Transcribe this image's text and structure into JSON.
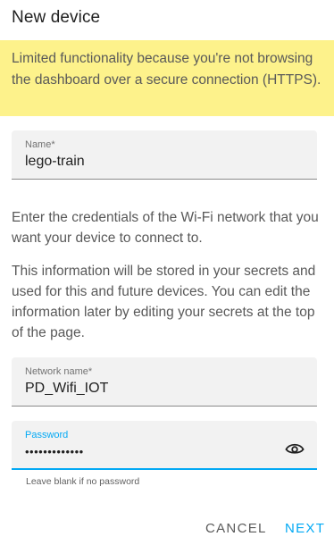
{
  "dialog": {
    "title": "New device",
    "warning": "Limited functionality because you're not browsing the dashboard over a secure connection (HTTPS).",
    "name_field": {
      "label": "Name*",
      "value": "lego-train"
    },
    "instructions": "Enter the credentials of the Wi-Fi network that you want your device to connect to.",
    "secrets_info": "This information will be stored in your secrets and used for this and future devices. You can edit the information later by editing your secrets at the top of the page.",
    "network_field": {
      "label": "Network name*",
      "value": "PD_Wifi_IOT"
    },
    "password_field": {
      "label": "Password",
      "value": "•••••••••••••",
      "toggle_icon": "eye-icon",
      "helper": "Leave blank if no password"
    },
    "actions": {
      "cancel": "CANCEL",
      "next": "NEXT"
    },
    "colors": {
      "warning_bg": "#fdf28b",
      "accent": "#03a9f4",
      "field_bg": "#f2f2f2"
    }
  }
}
